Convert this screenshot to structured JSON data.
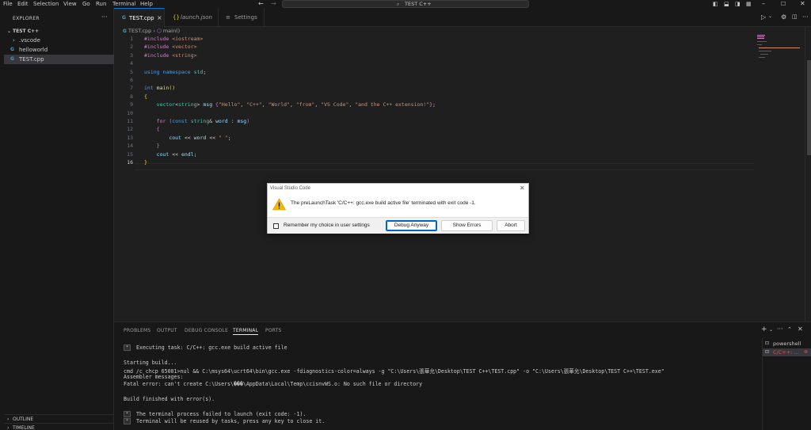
{
  "window": {
    "menu": [
      "File",
      "Edit",
      "Selection",
      "View",
      "Go",
      "Run",
      "Terminal",
      "Help"
    ],
    "search_text": "TEST C++"
  },
  "sidebar": {
    "header": "EXPLORER",
    "folder": "TEST C++",
    "items": [
      {
        "label": ".vscode",
        "type": "folder"
      },
      {
        "label": "helloworld",
        "type": "file"
      },
      {
        "label": "TEST.cpp",
        "type": "file"
      }
    ],
    "outline": "OUTLINE",
    "timeline": "TIMELINE"
  },
  "tabs": [
    {
      "label": "TEST.cpp",
      "icon": "C++",
      "active": true
    },
    {
      "label": "launch.json",
      "icon": "{}",
      "active": false
    },
    {
      "label": "Settings",
      "icon": "≡",
      "active": false
    }
  ],
  "breadcrumb": {
    "file": "TEST.cpp",
    "symbol": "main()"
  },
  "editor": {
    "line_numbers": [
      "1",
      "2",
      "3",
      "4",
      "5",
      "6",
      "7",
      "8",
      "9",
      "10",
      "11",
      "12",
      "13",
      "14",
      "15",
      "16"
    ],
    "current_line": "16"
  },
  "dialog": {
    "title": "Visual Studio Code",
    "message": "The preLaunchTask 'C/C++: gcc.exe build active file' terminated with exit code -1.",
    "checkbox_label": "Remember my choice in user settings",
    "buttons": {
      "debug": "Debug Anyway",
      "errors": "Show Errors",
      "abort": "Abort"
    }
  },
  "panel": {
    "tabs": [
      "PROBLEMS",
      "OUTPUT",
      "DEBUG CONSOLE",
      "TERMINAL",
      "PORTS"
    ],
    "active_tab": "TERMINAL",
    "terminal_lines": {
      "l1": "Executing task: C/C++: gcc.exe build active file",
      "l2": "Starting build...",
      "l3": "cmd /c chcp 65001>nul && C:\\msys64\\ucrt64\\bin\\gcc.exe -fdiagnostics-color=always -g \"C:\\Users\\張華允\\Desktop\\TEST C++\\TEST.cpp\" -o \"C:\\Users\\張華允\\Desktop\\TEST C++\\TEST.exe\"",
      "l4": "Assembler messages:",
      "l5": "Fatal error: can't create C:\\Users\\���\\AppData\\Local\\Temp\\ccisnvWS.o: No such file or directory",
      "l6": "Build finished with error(s).",
      "l7": "The terminal process failed to launch (exit code: -1).",
      "l8": "Terminal will be reused by tasks, press any key to close it."
    },
    "terminals": [
      {
        "label": "powershell",
        "selected": false
      },
      {
        "label": "C/C++: ...",
        "selected": true
      }
    ]
  }
}
